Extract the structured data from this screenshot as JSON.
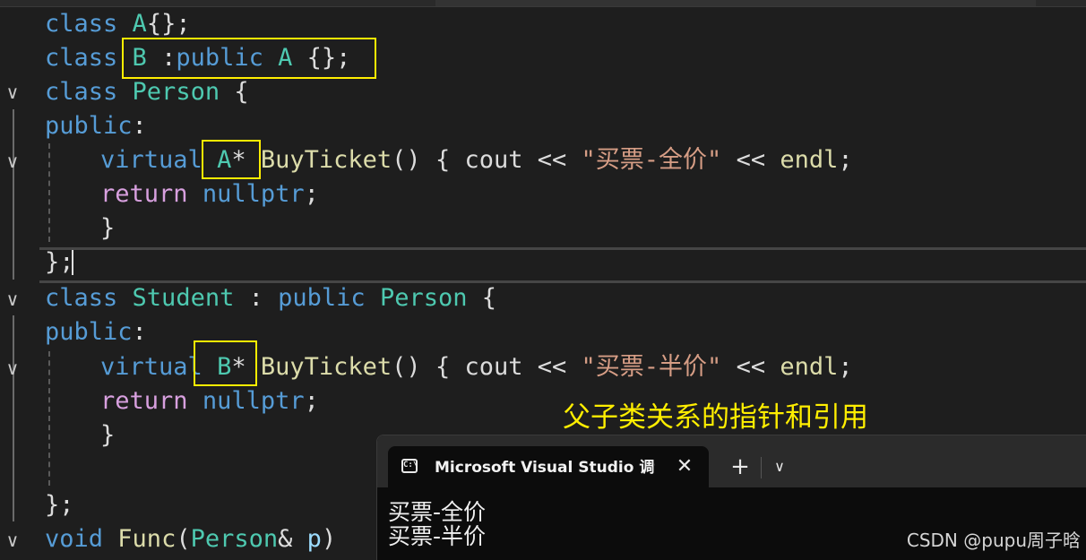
{
  "editor": {
    "fold_glyph": "∨",
    "lines": [
      {
        "parts": [
          "class",
          " ",
          "A",
          "{};"
        ]
      },
      {
        "parts": [
          "class",
          " ",
          "B",
          " :",
          "public",
          " ",
          "A",
          " {};"
        ]
      },
      {
        "parts": [
          "class",
          " ",
          "Person",
          " {"
        ]
      },
      {
        "parts": [
          "public",
          ":"
        ]
      },
      {
        "parts": [
          "virtual",
          " ",
          "A",
          "*",
          " ",
          "BuyTicket",
          "()",
          " { ",
          "cout",
          " << ",
          "\"买票-全价\"",
          " << ",
          "endl",
          ";"
        ]
      },
      {
        "parts": [
          "return",
          " ",
          "nullptr",
          ";"
        ]
      },
      {
        "parts": [
          "}"
        ]
      },
      {
        "parts": [
          "};"
        ]
      },
      {
        "parts": [
          "class",
          " ",
          "Student",
          " : ",
          "public",
          " ",
          "Person",
          " {"
        ]
      },
      {
        "parts": [
          "public",
          ":"
        ]
      },
      {
        "parts": [
          "virtual",
          " ",
          "B",
          "*",
          " ",
          "BuyTicket",
          "()",
          " { ",
          "cout",
          " << ",
          "\"买票-半价\"",
          " << ",
          "endl",
          ";"
        ]
      },
      {
        "parts": [
          "return",
          " ",
          "nullptr",
          ";"
        ]
      },
      {
        "parts": [
          "}"
        ]
      },
      {
        "parts": [
          ""
        ]
      },
      {
        "parts": [
          "};"
        ]
      },
      {
        "parts": [
          "void",
          " ",
          "Func",
          "(",
          "Person",
          "&",
          " ",
          "p",
          ")"
        ]
      }
    ],
    "colors": {
      "keyword": "#569cd6",
      "control_keyword": "#d8a0df",
      "type": "#4ec9b0",
      "function": "#dcdcaa",
      "string": "#d69d85",
      "highlight_box": "#ffee00"
    }
  },
  "annotation": {
    "text": "父子类关系的指针和引用"
  },
  "console": {
    "icon": "C:\\",
    "tab_title": "Microsoft Visual Studio 调试控制台",
    "close_icon": "✕",
    "new_tab_icon": "+",
    "dropdown_icon": "∨",
    "output": [
      "买票-全价",
      "买票-半价"
    ]
  },
  "watermark": "CSDN @pupu周子晗"
}
